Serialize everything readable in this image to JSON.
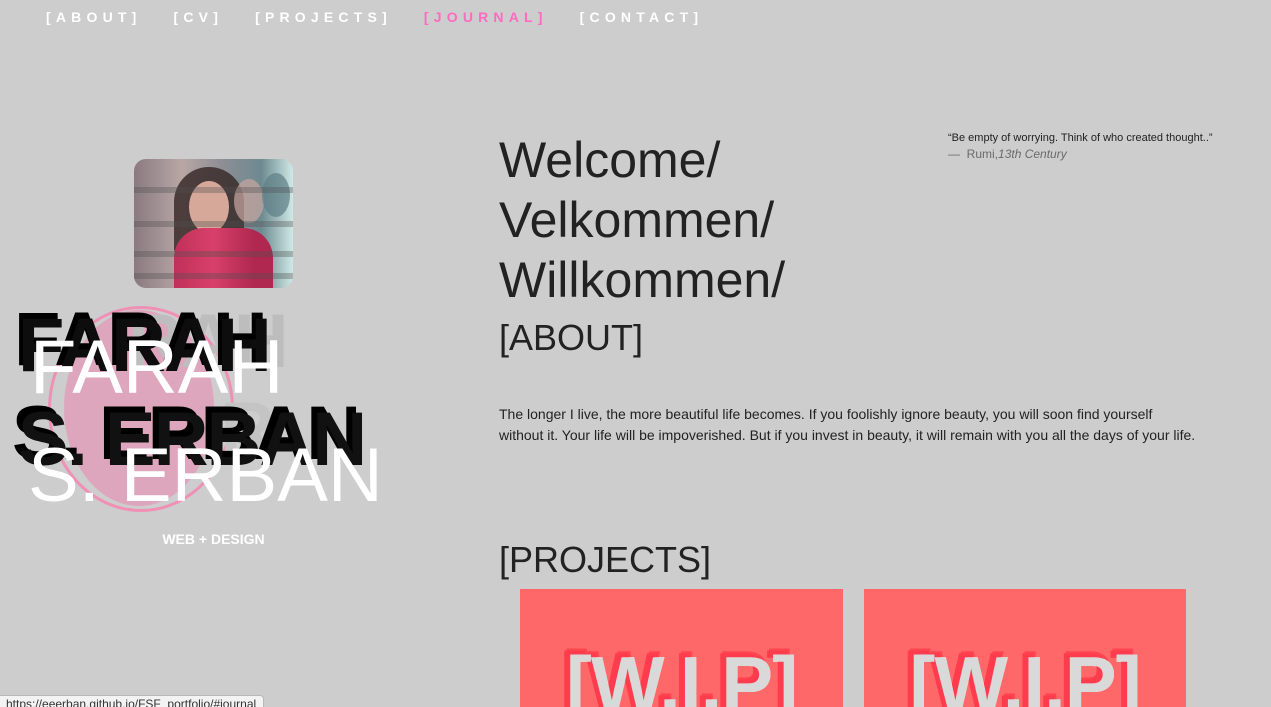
{
  "nav": {
    "items": [
      {
        "label": "[ABOUT]",
        "active": false
      },
      {
        "label": "[CV]",
        "active": false
      },
      {
        "label": "[PROJECTS]",
        "active": false
      },
      {
        "label": "[JOURNAL]",
        "active": true
      },
      {
        "label": "[CONTACT]",
        "active": false
      }
    ],
    "active_color": "#ff6ac1"
  },
  "sidebar": {
    "name_line1": "FARAH",
    "name_line2": "S. ERBAN",
    "ghost_line1": "RAH",
    "ghost_line2": "R",
    "tagline": "WEB + DESIGN"
  },
  "main": {
    "welcome_lines": [
      "Welcome/",
      "Velkommen/",
      "Willkommen/"
    ],
    "about_heading": "[ABOUT]",
    "about_text": "The longer I live, the more beautiful life becomes. If you foolishly ignore beauty, you will soon find yourself without it. Your life will be impoverished. But if you invest in beauty, it will remain with you all the days of your life.",
    "projects_heading": "[PROJECTS]",
    "project_cards": [
      {
        "label": "[W.I.P]"
      },
      {
        "label": "[W.I.P]"
      }
    ],
    "card_color": "#ff6868"
  },
  "quote": {
    "text": "“Be empty of worrying. Think of who created thought..”",
    "dash": "—",
    "author": "Rumi,",
    "era": "13th Century"
  },
  "status_bar": {
    "url": "https://eeerban.github.io/FSF_portfolio/#journal"
  }
}
